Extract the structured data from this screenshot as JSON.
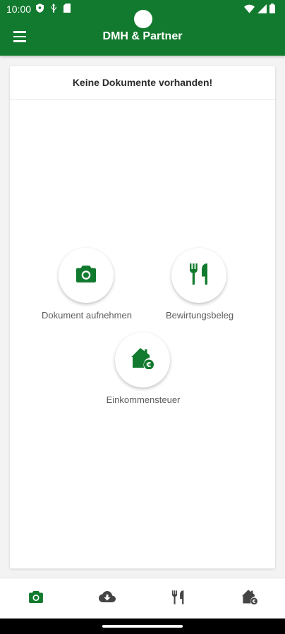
{
  "status_bar": {
    "time": "10:00",
    "left_icons": [
      "shield-icon",
      "usb-icon",
      "sim-card-icon"
    ],
    "right_icons": [
      "wifi-icon",
      "signal-icon",
      "battery-icon"
    ]
  },
  "app_bar": {
    "title": "DMH & Partner",
    "menu_icon": "hamburger-menu-icon"
  },
  "content": {
    "empty_message": "Keine Dokumente vorhanden!"
  },
  "actions": [
    {
      "label": "Dokument aufnehmen",
      "icon": "camera-icon"
    },
    {
      "label": "Bewirtungsbeleg",
      "icon": "restaurant-icon"
    },
    {
      "label": "Einkommensteuer",
      "icon": "home-euro-icon"
    }
  ],
  "bottom_nav": {
    "items": [
      {
        "icon": "camera-icon",
        "selected": true
      },
      {
        "icon": "cloud-download-icon",
        "selected": false
      },
      {
        "icon": "restaurant-icon",
        "selected": false
      },
      {
        "icon": "home-euro-icon",
        "selected": false
      }
    ]
  },
  "colors": {
    "brand_green": "#127a2e",
    "nav_inactive": "#444444",
    "label_gray": "#5c5c5c"
  }
}
